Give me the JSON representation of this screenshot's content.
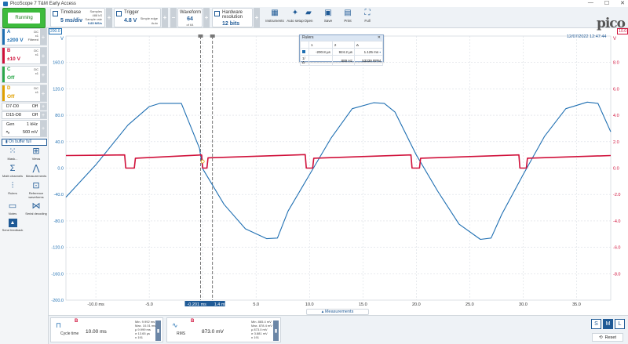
{
  "window": {
    "title": "PicoScope 7 T&M Early Access",
    "controls": [
      "—",
      "☐",
      "✕"
    ]
  },
  "toolbar": {
    "run_label": "Running",
    "timebase": {
      "label": "Timebase",
      "value": "5 ms/div",
      "samples_label": "Samples",
      "samples_value": "488 kS",
      "sample_rate_label": "Sample rate",
      "sample_rate_value": "9.85 MS/s"
    },
    "trigger": {
      "label": "Trigger",
      "value": "4.8 V",
      "mode": "Simple edge",
      "sub": "Auto"
    },
    "waveform": {
      "label": "Waveform",
      "value": "64",
      "sub": "of 64"
    },
    "resolution": {
      "label": "Hardware resolution",
      "value": "12 bits"
    },
    "tools": [
      {
        "label": "Instruments",
        "icon": "instruments-icon"
      },
      {
        "label": "Auto setup",
        "icon": "wand-icon"
      },
      {
        "label": "Open",
        "icon": "folder-icon"
      },
      {
        "label": "Save",
        "icon": "save-icon"
      },
      {
        "label": "Print",
        "icon": "print-icon"
      },
      {
        "label": "Full",
        "icon": "fullscreen-icon"
      }
    ],
    "brand": "pico"
  },
  "channels": [
    {
      "name": "A",
      "range": "±200 V",
      "coupling": "DC",
      "probe": "x1",
      "extra": "Filtered",
      "color": "#1f6fb2"
    },
    {
      "name": "B",
      "range": "±10 V",
      "coupling": "DC",
      "probe": "x1",
      "extra": "",
      "color": "#d0103a"
    },
    {
      "name": "C",
      "range": "Off",
      "coupling": "DC",
      "probe": "x1",
      "extra": "",
      "color": "#2ba84a"
    },
    {
      "name": "D",
      "range": "Off",
      "coupling": "DC",
      "probe": "x1",
      "extra": "",
      "color": "#e0a000"
    }
  ],
  "digital": [
    {
      "name": "D7-D0",
      "state": "Off"
    },
    {
      "name": "D15-D8",
      "state": "Off"
    }
  ],
  "generator": {
    "label": "Gen",
    "freq": "1 kHz",
    "amp": "500 mV"
  },
  "buffer_label": "On buffer full",
  "left_tools": [
    {
      "label": "Mask...",
      "icon": "mask-icon"
    },
    {
      "label": "Views",
      "icon": "views-icon"
    },
    {
      "label": "Math channels",
      "icon": "sigma-icon"
    },
    {
      "label": "Measurements",
      "icon": "measurements-icon"
    },
    {
      "label": "Rulers",
      "icon": "rulers-icon"
    },
    {
      "label": "Reference waveforms",
      "icon": "reference-icon"
    },
    {
      "label": "Notes",
      "icon": "notes-icon"
    },
    {
      "label": "Serial decoding",
      "icon": "serial-icon"
    },
    {
      "label": "Send feedback",
      "icon": "feedback-icon"
    }
  ],
  "plot": {
    "datetime": "12/07/2022 12:47:44",
    "left_axis_unit": "V",
    "right_axis_unit": "V",
    "left_axis_badge": "200.0",
    "right_axis_badge": "10.0",
    "left_ticks": [
      "160.0",
      "120.0",
      "80.0",
      "40.0",
      "0.0",
      "-40.0",
      "-80.0",
      "-120.0",
      "-160.0",
      "-200.0"
    ],
    "right_ticks": [
      "8.0",
      "6.0",
      "4.0",
      "2.0",
      "0.0",
      "-2.0",
      "-4.0",
      "-6.0",
      "-8.0"
    ],
    "x_ticks": [
      "-10.0 ms",
      "-5.0",
      "0.0",
      "5.0",
      "10.0",
      "15.0",
      "20.0",
      "25.0",
      "30.0",
      "35.0"
    ],
    "x_tick_values": [
      -10,
      -5,
      0,
      5,
      10,
      15,
      20,
      25,
      30,
      35
    ],
    "x_range": [
      -12.8,
      38.2
    ],
    "cursor_labels": [
      "-0.201 ms",
      "1.4 ms"
    ],
    "cursor_values": [
      -0.2,
      0.92
    ],
    "trigger_marker_value": 0.0
  },
  "chart_data": {
    "type": "line",
    "xlim": [
      -12.8,
      38.2
    ],
    "series": [
      {
        "axis": "left",
        "ylim": [
          -200,
          200
        ],
        "color": "#1f6fb2",
        "x": [
          -12.8,
          -10,
          -7,
          -5,
          -4,
          -2,
          -0.3,
          0,
          2,
          4,
          6,
          7,
          8,
          10,
          12,
          14,
          16,
          17,
          18,
          20,
          22,
          24,
          26,
          27,
          28,
          30,
          32,
          34,
          36,
          37,
          38.2
        ],
        "y": [
          -44,
          5,
          65,
          93,
          98,
          98,
          30,
          -1,
          -55,
          -92,
          -107,
          -106,
          -65,
          -10,
          45,
          90,
          99,
          98,
          85,
          20,
          -35,
          -85,
          -108,
          -106,
          -70,
          -10,
          48,
          90,
          100,
          98,
          55
        ]
      },
      {
        "axis": "right",
        "ylim": [
          -10,
          10
        ],
        "color": "#d0103a",
        "x": [
          -12.8,
          -7.3,
          -7.2,
          -6.4,
          -6.3,
          -0.1,
          0.0,
          0.4,
          0.5,
          9.6,
          9.7,
          10.3,
          10.4,
          19.5,
          19.6,
          20.3,
          20.4,
          29.6,
          29.7,
          30.3,
          30.4,
          38.2
        ],
        "y": [
          0.95,
          1.0,
          0.0,
          0.0,
          0.75,
          1.0,
          0.0,
          0.0,
          0.78,
          1.02,
          0.0,
          0.0,
          0.75,
          1.0,
          0.0,
          0.0,
          0.75,
          1.0,
          0.0,
          0.0,
          0.75,
          0.95
        ]
      }
    ]
  },
  "rulers_panel": {
    "title": "Rulers",
    "close": "✕",
    "headers": [
      "",
      "1",
      "2",
      "Δ"
    ],
    "row1": [
      "",
      "-200.8 µs",
      "924.2 µs",
      "1.125 ms"
    ],
    "row2": [
      "1/Δ",
      "",
      "889 Hz",
      "53339 RPM"
    ]
  },
  "measurements_label": "Measurements",
  "measurements": [
    {
      "channel": "B",
      "name": "Cycle time",
      "value": "10.00 ms",
      "stats": [
        "Min. 9.992 ms",
        "Max. 10.01 ms",
        "µ 9.999 ms",
        "σ 13.65 µs",
        "n 191"
      ]
    },
    {
      "channel": "B",
      "name": "RMS",
      "value": "873.0 mV",
      "stats": [
        "Min. 865.4 mV",
        "Max. 878.4 mV",
        "µ 873.0 mV",
        "σ 3.881 mV",
        "n 191"
      ]
    }
  ],
  "view_sizes": [
    "S",
    "M",
    "L"
  ],
  "reset_label": "Reset"
}
